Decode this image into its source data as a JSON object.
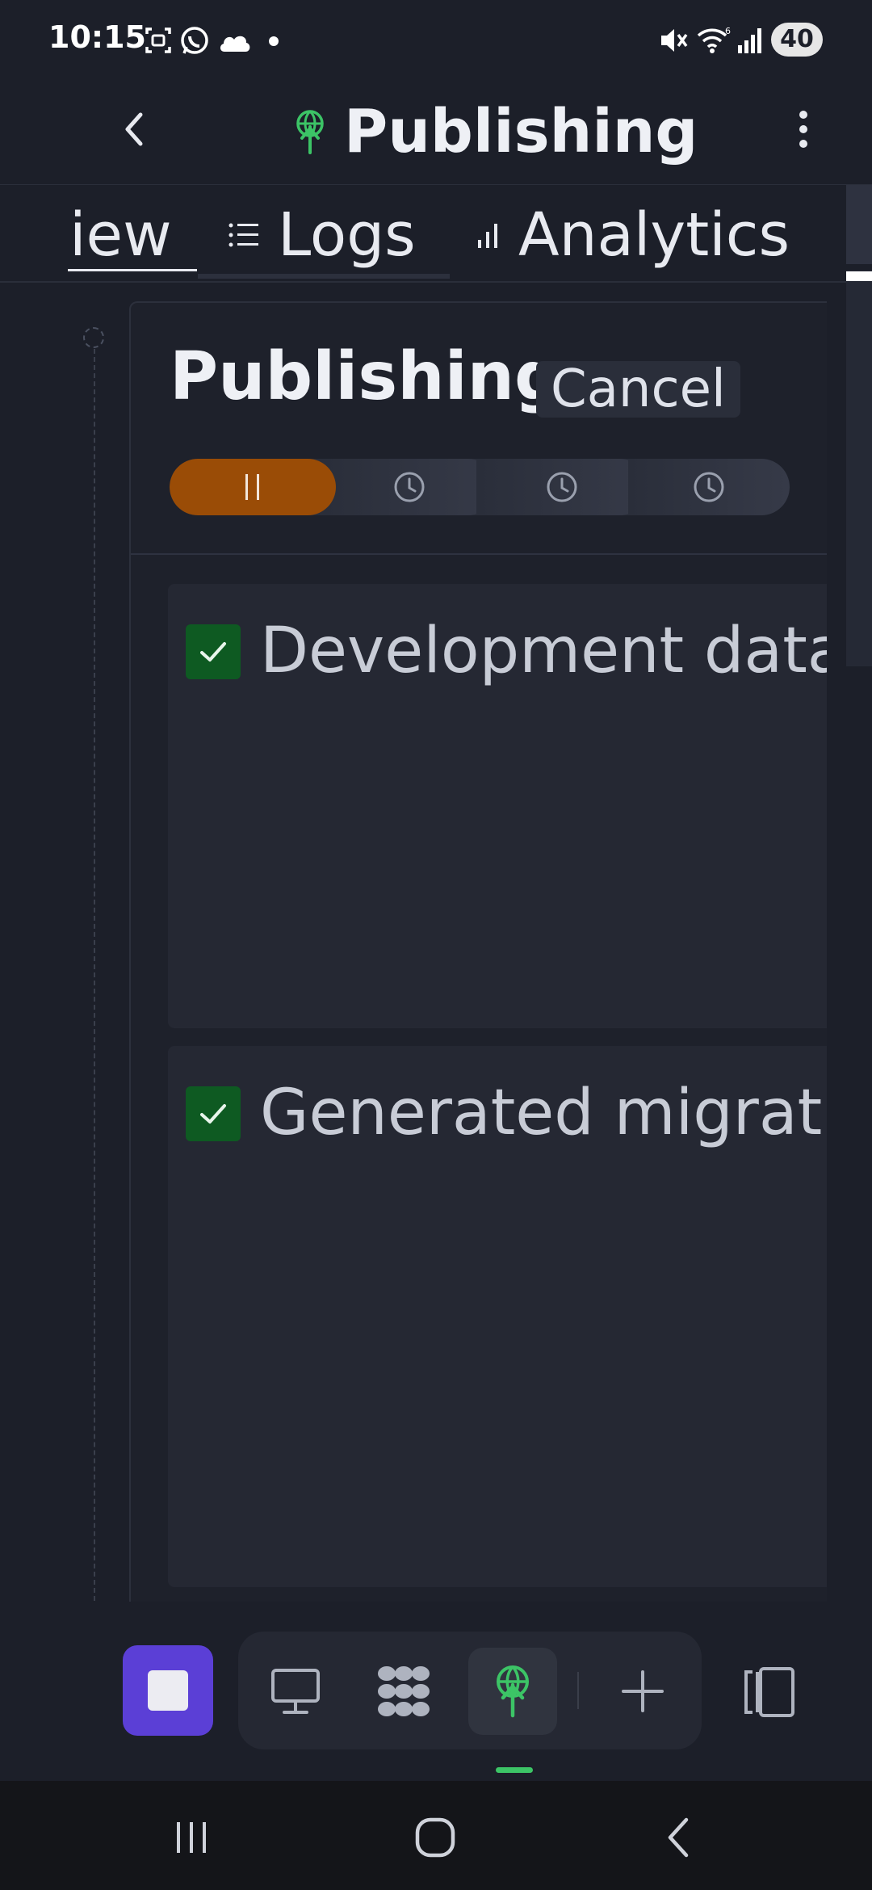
{
  "status_bar": {
    "time": "10:15",
    "battery": "40",
    "left_icons": [
      "screenshot-icon",
      "whatsapp-icon",
      "cloud-icon",
      "dot-icon"
    ],
    "right_icons": [
      "mute-icon",
      "wifi-icon",
      "signal-icon"
    ]
  },
  "header": {
    "title": "Publishing",
    "icon": "publish-icon",
    "accent": "#3cc466"
  },
  "tabs": [
    {
      "label": "iew",
      "icon": "",
      "active": true
    },
    {
      "label": "Logs",
      "icon": "list-icon",
      "active": false
    },
    {
      "label": "Analytics",
      "icon": "bar-chart-icon",
      "active": false
    }
  ],
  "card": {
    "title": "Publishing",
    "cancel_label": "Cancel",
    "stages": [
      {
        "status": "paused",
        "icon": "pause-icon",
        "color": "#9a4c06"
      },
      {
        "status": "pending",
        "icon": "clock-icon"
      },
      {
        "status": "pending",
        "icon": "clock-icon"
      },
      {
        "status": "pending",
        "icon": "clock-icon"
      }
    ],
    "steps": [
      {
        "label": "Development databa",
        "checked": true
      },
      {
        "label": "Generated migration",
        "checked": true
      }
    ]
  },
  "dock": {
    "stop_color": "#5b3fd6",
    "items": [
      "desktop-icon",
      "workflow-icon",
      "publish-icon",
      "plus-icon"
    ],
    "active_item": "publish-icon"
  },
  "nav": [
    "recent-apps-icon",
    "home-icon",
    "back-icon"
  ]
}
